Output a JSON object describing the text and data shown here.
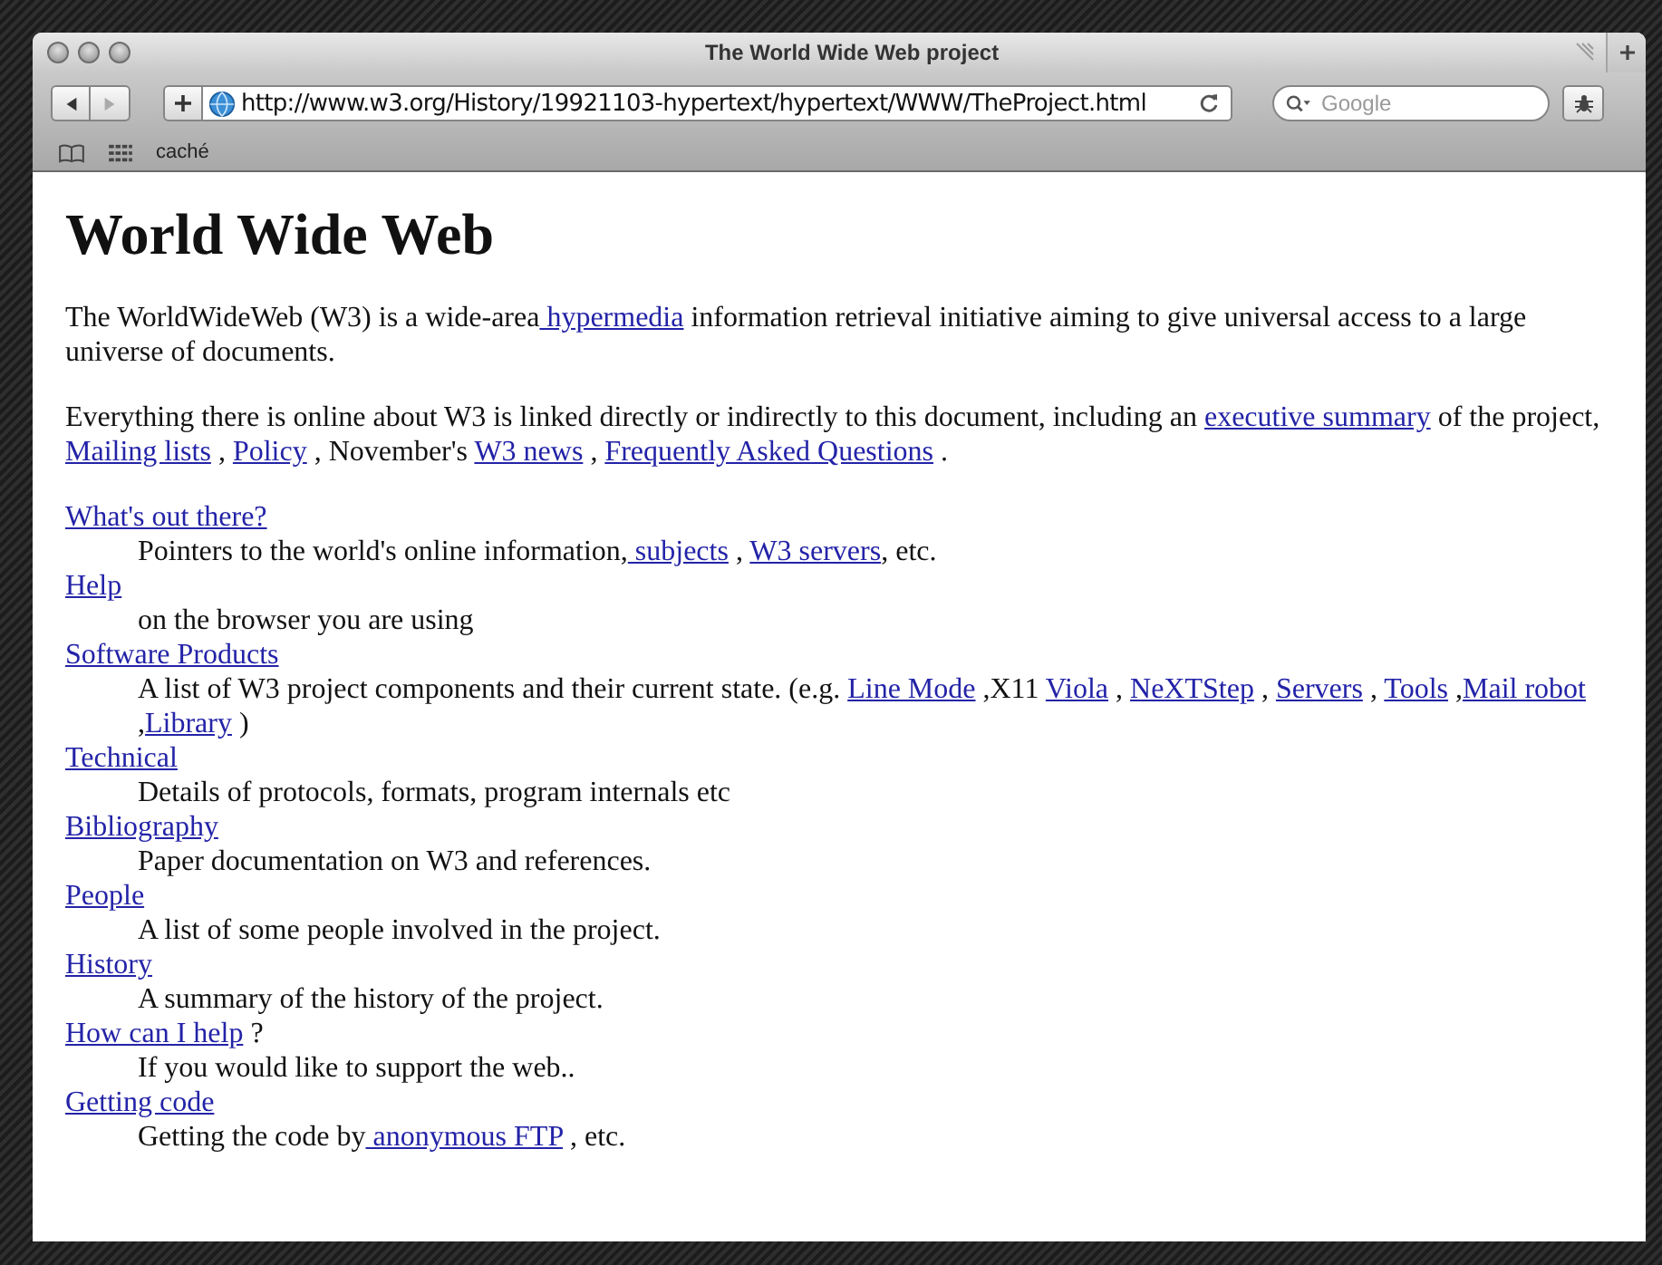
{
  "window": {
    "title": "The World Wide Web project"
  },
  "toolbar": {
    "url": "http://www.w3.org/History/19921103-hypertext/hypertext/WWW/TheProject.html",
    "search": {
      "placeholder": "Google"
    }
  },
  "bookmarks": [
    "caché"
  ],
  "page": {
    "heading": "World Wide Web",
    "paragraphs": [
      [
        {
          "kind": "text",
          "text": "The WorldWideWeb (W3) is a wide-area"
        },
        {
          "kind": "link",
          "text": " hypermedia"
        },
        {
          "kind": "text",
          "text": " information retrieval initiative aiming to give universal access to a large universe of documents."
        }
      ],
      [
        {
          "kind": "text",
          "text": "Everything there is online about W3 is linked directly or indirectly to this document, including an "
        },
        {
          "kind": "link",
          "text": "executive summary"
        },
        {
          "kind": "text",
          "text": " of the project, "
        },
        {
          "kind": "link",
          "text": "Mailing lists"
        },
        {
          "kind": "text",
          "text": " , "
        },
        {
          "kind": "link",
          "text": "Policy"
        },
        {
          "kind": "text",
          "text": " , November's "
        },
        {
          "kind": "link",
          "text": "W3 news"
        },
        {
          "kind": "text",
          "text": " , "
        },
        {
          "kind": "link",
          "text": "Frequently Asked Questions"
        },
        {
          "kind": "text",
          "text": " ."
        }
      ]
    ],
    "items": [
      {
        "term": "What's out there?",
        "description": [
          {
            "kind": "text",
            "text": "Pointers to the world's online information,"
          },
          {
            "kind": "link",
            "text": " subjects"
          },
          {
            "kind": "text",
            "text": " , "
          },
          {
            "kind": "link",
            "text": "W3 servers"
          },
          {
            "kind": "text",
            "text": ", etc."
          }
        ]
      },
      {
        "term": "Help",
        "description": [
          {
            "kind": "text",
            "text": "on the browser you are using"
          }
        ]
      },
      {
        "term": "Software Products",
        "description": [
          {
            "kind": "text",
            "text": "A list of W3 project components and their current state. (e.g. "
          },
          {
            "kind": "link",
            "text": "Line Mode"
          },
          {
            "kind": "text",
            "text": " ,X11 "
          },
          {
            "kind": "link",
            "text": "Viola"
          },
          {
            "kind": "text",
            "text": " , "
          },
          {
            "kind": "link",
            "text": "NeXTStep"
          },
          {
            "kind": "text",
            "text": " , "
          },
          {
            "kind": "link",
            "text": "Servers"
          },
          {
            "kind": "text",
            "text": " , "
          },
          {
            "kind": "link",
            "text": "Tools"
          },
          {
            "kind": "text",
            "text": " ,"
          },
          {
            "kind": "link",
            "text": "Mail robot"
          },
          {
            "kind": "text",
            "text": " ,"
          },
          {
            "kind": "link",
            "text": "Library"
          },
          {
            "kind": "text",
            "text": " )"
          }
        ]
      },
      {
        "term": "Technical",
        "description": [
          {
            "kind": "text",
            "text": "Details of protocols, formats, program internals etc"
          }
        ]
      },
      {
        "term": "Bibliography",
        "description": [
          {
            "kind": "text",
            "text": "Paper documentation on W3 and references."
          }
        ]
      },
      {
        "term": "People",
        "description": [
          {
            "kind": "text",
            "text": "A list of some people involved in the project."
          }
        ]
      },
      {
        "term": "History",
        "description": [
          {
            "kind": "text",
            "text": "A summary of the history of the project."
          }
        ]
      },
      {
        "term": "How can I help",
        "term_suffix": " ?",
        "description": [
          {
            "kind": "text",
            "text": "If you would like to support the web.."
          }
        ]
      },
      {
        "term": "Getting code",
        "description": [
          {
            "kind": "text",
            "text": "Getting the code by"
          },
          {
            "kind": "link",
            "text": " anonymous FTP"
          },
          {
            "kind": "text",
            "text": " , etc."
          }
        ]
      }
    ]
  }
}
